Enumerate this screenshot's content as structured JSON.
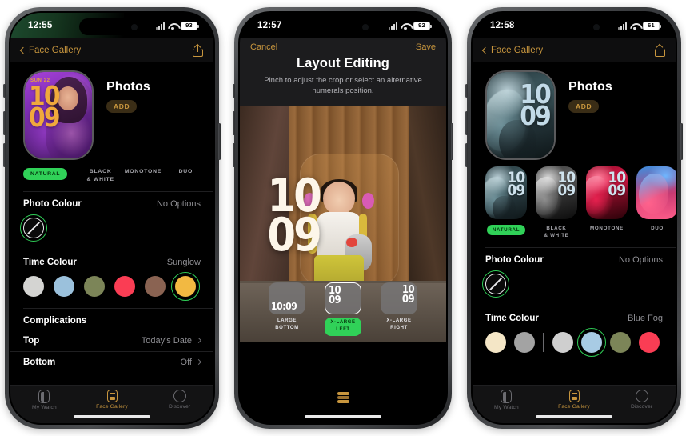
{
  "phones": [
    {
      "id": "phone-1",
      "status": {
        "time": "12:55",
        "battery": "93",
        "signal_icon": "cellular-bars-icon",
        "wifi_icon": "wifi-icon",
        "battery_icon": "battery-icon"
      },
      "nav": {
        "back_label": "Face Gallery",
        "back_icon": "chevron-left-icon",
        "share_icon": "share-icon"
      },
      "hero": {
        "title": "Photos",
        "add_label": "ADD",
        "face_date": "SUN 22",
        "face_hour": "10",
        "face_minute": "09"
      },
      "styles": [
        {
          "label": "NATURAL",
          "selected": true
        },
        {
          "label": "BLACK\n& WHITE",
          "line1": "BLACK",
          "line2": "& WHITE",
          "selected": false
        },
        {
          "label": "MONOTONE",
          "selected": false
        },
        {
          "label": "DUO",
          "selected": false
        }
      ],
      "photo_colour": {
        "label": "Photo Colour",
        "value": "No Options",
        "swatch_icon": "no-colour-slash-icon"
      },
      "time_colour": {
        "label": "Time Colour",
        "value": "Sunglow",
        "swatches": [
          "#d4d4d2",
          "#9bc1dc",
          "#7c8558",
          "#fa3d54",
          "#8a6352",
          "#f2b942"
        ],
        "selected_index": 5
      },
      "complications": {
        "header": "Complications",
        "rows": [
          {
            "label": "Top",
            "value": "Today's Date"
          },
          {
            "label": "Bottom",
            "value": "Off"
          }
        ]
      },
      "tabs": [
        {
          "label": "My Watch",
          "icon": "my-watch-icon",
          "active": false
        },
        {
          "label": "Face Gallery",
          "icon": "face-gallery-icon",
          "active": true
        },
        {
          "label": "Discover",
          "icon": "discover-compass-icon",
          "active": false
        }
      ]
    },
    {
      "id": "phone-2",
      "status": {
        "time": "12:57",
        "battery": "92"
      },
      "edit": {
        "cancel_label": "Cancel",
        "save_label": "Save",
        "title": "Layout Editing",
        "subtitle": "Pinch to adjust the crop or select an alternative numerals position.",
        "stack_icon": "stack-layers-icon"
      },
      "preview": {
        "hour": "10",
        "minute": "09"
      },
      "layouts": [
        {
          "cap_line1": "LARGE",
          "cap_line2": "BOTTOM",
          "time": "10:09",
          "selected": false
        },
        {
          "cap_line1": "X-LARGE",
          "cap_line2": "LEFT",
          "hour": "10",
          "minute": "09",
          "selected": true
        },
        {
          "cap_line1": "X-LARGE",
          "cap_line2": "RIGHT",
          "hour": "10",
          "minute": "09",
          "selected": false
        }
      ]
    },
    {
      "id": "phone-3",
      "status": {
        "time": "12:58",
        "battery": "61"
      },
      "nav": {
        "back_label": "Face Gallery"
      },
      "hero": {
        "title": "Photos",
        "add_label": "ADD",
        "face_hour": "10",
        "face_minute": "09"
      },
      "gallery": [
        {
          "cap": "NATURAL",
          "hour": "10",
          "minute": "09",
          "selected": true
        },
        {
          "cap_line1": "BLACK",
          "cap_line2": "& WHITE",
          "hour": "10",
          "minute": "09",
          "selected": false
        },
        {
          "cap": "MONOTONE",
          "hour": "10",
          "minute": "09",
          "selected": false
        },
        {
          "cap": "DUO",
          "hour": "10",
          "minute": "09",
          "selected": false
        }
      ],
      "photo_colour": {
        "label": "Photo Colour",
        "value": "No Options"
      },
      "time_colour": {
        "label": "Time Colour",
        "value": "Blue Fog",
        "swatches": [
          "#f4e6c6",
          "#a3a3a3",
          "divider",
          "#cfcfcf",
          "#a8cbe4",
          "#7c8558",
          "#fa3d54"
        ],
        "selected_index": 4
      },
      "tabs": [
        {
          "label": "My Watch",
          "active": false
        },
        {
          "label": "Face Gallery",
          "active": true
        },
        {
          "label": "Discover",
          "active": false
        }
      ]
    }
  ],
  "colors": {
    "accent_gold": "#c8963e",
    "selection_green": "#30d158",
    "secondary_text": "#8e8e93"
  }
}
